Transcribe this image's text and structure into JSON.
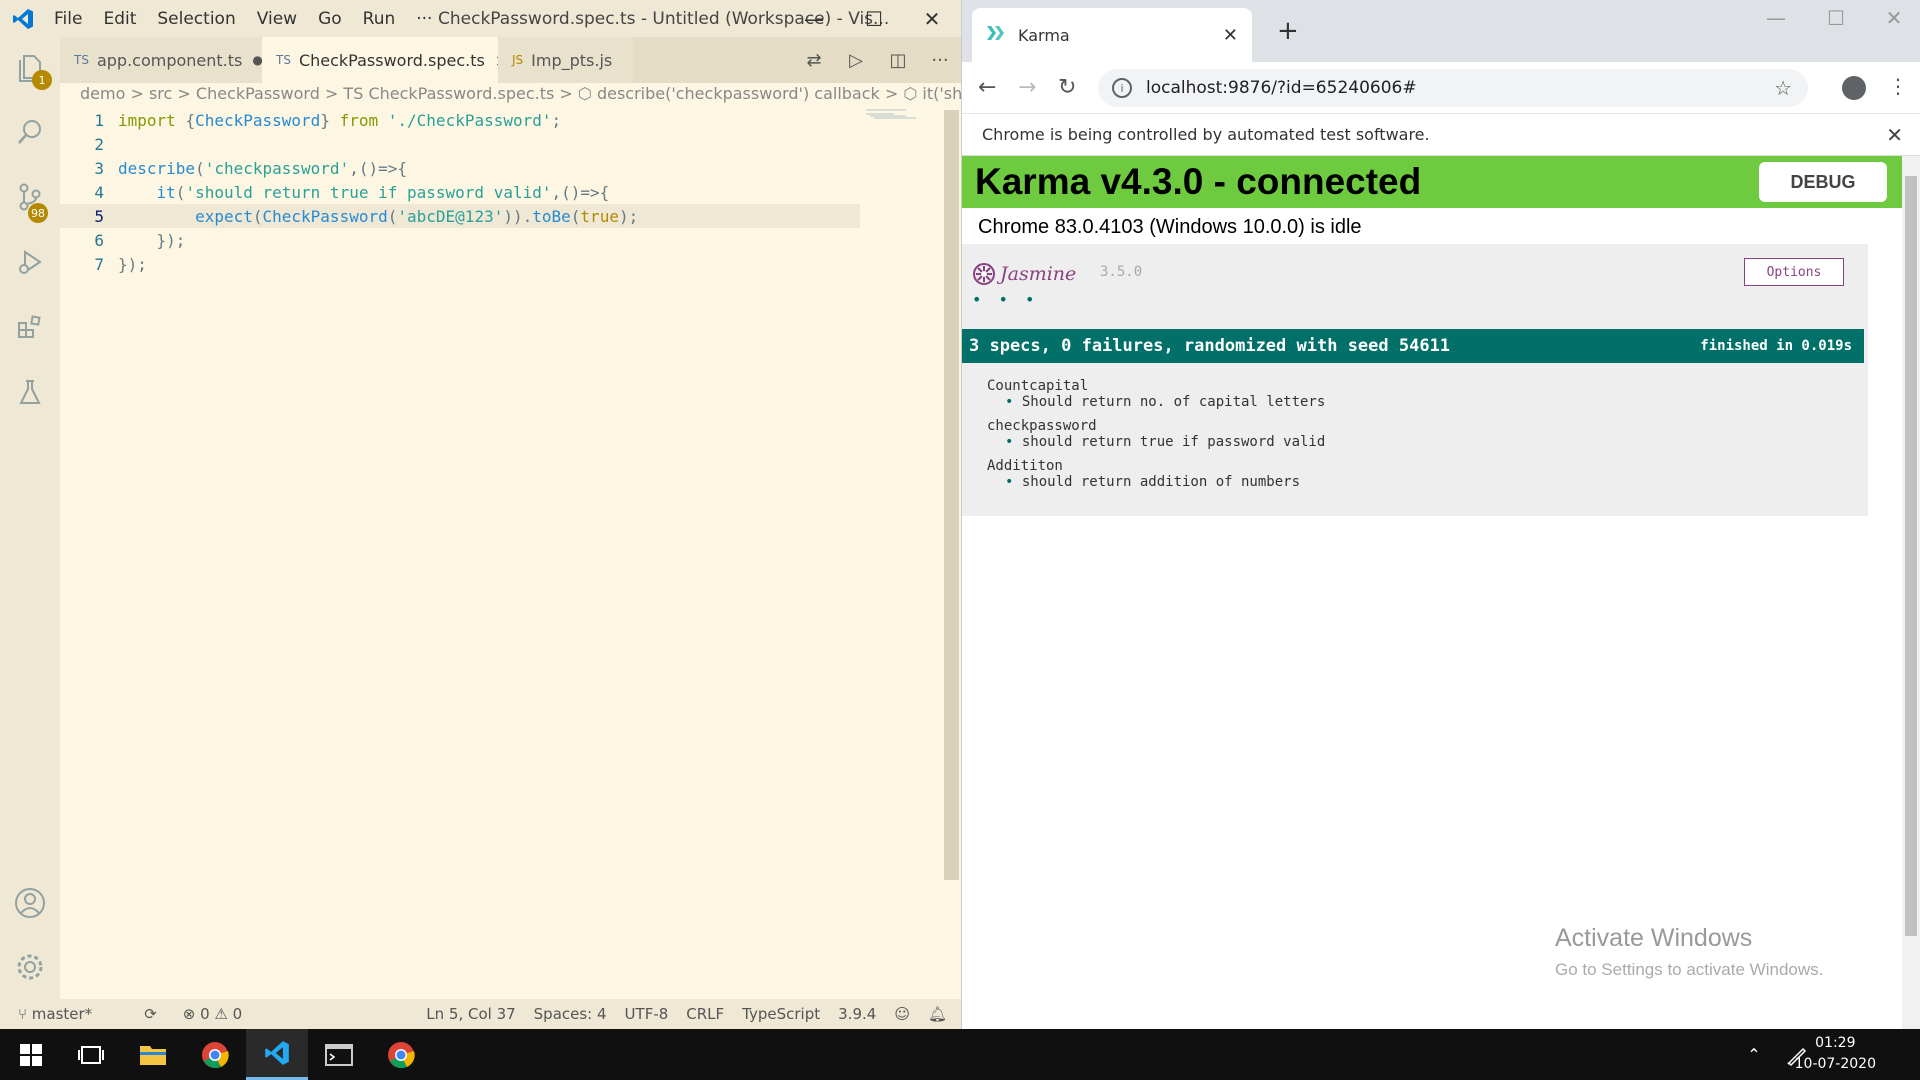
{
  "vscode": {
    "menu": [
      "File",
      "Edit",
      "Selection",
      "View",
      "Go",
      "Run",
      "···"
    ],
    "window_title": "CheckPassword.spec.ts - Untitled (Workspace) - Vis...",
    "tabs": [
      {
        "lang": "TS",
        "label": "app.component.ts",
        "modified": "●"
      },
      {
        "lang": "TS",
        "label": "CheckPassword.spec.ts",
        "close": "×"
      },
      {
        "lang": "JS",
        "label": "Imp_pts.js"
      }
    ],
    "breadcrumb": "demo > src > CheckPassword > TS CheckPassword.spec.ts > ⬡ describe('checkpassword') callback > ⬡ it('should return",
    "badges": {
      "explorer": "1",
      "scm": "98"
    },
    "code": [
      {
        "num": "1",
        "text": "import {CheckPassword} from './CheckPassword';"
      },
      {
        "num": "2",
        "text": ""
      },
      {
        "num": "3",
        "text": "describe('checkpassword',()=>{"
      },
      {
        "num": "4",
        "text": "    it('should return true if password valid',()=>{"
      },
      {
        "num": "5",
        "text": "        expect(CheckPassword('abcDE@123')).toBe(true);"
      },
      {
        "num": "6",
        "text": "    });"
      },
      {
        "num": "7",
        "text": "});"
      }
    ],
    "status": {
      "branch": "master*",
      "errors": "⊗ 0 ⚠ 0",
      "position": "Ln 5, Col 37",
      "spaces": "Spaces: 4",
      "encoding": "UTF-8",
      "eol": "CRLF",
      "language": "TypeScript",
      "version": "3.9.4"
    }
  },
  "chrome": {
    "tab_title": "Karma",
    "url": "localhost:9876/?id=65240606#",
    "infobar": "Chrome is being controlled by automated test software.",
    "karma_title": "Karma v4.3.0 - connected",
    "debug_label": "DEBUG",
    "idle_text": "Chrome 83.0.4103 (Windows 10.0.0) is idle",
    "jasmine": {
      "name": "Jasmine",
      "version": "3.5.0",
      "options_label": "Options",
      "dots": "• • •",
      "summary": "3 specs, 0 failures, randomized with seed 54611",
      "finished": "finished in 0.019s",
      "suites": [
        {
          "name": "Countcapital",
          "spec": "Should return no. of capital letters"
        },
        {
          "name": "checkpassword",
          "spec": "should return true if password valid"
        },
        {
          "name": "Addititon",
          "spec": "should return addition of numbers"
        }
      ]
    },
    "watermark": "Activate Windows",
    "watermark_sub": "Go to Settings to activate Windows."
  },
  "taskbar": {
    "time": "01:29",
    "date": "10-07-2020"
  },
  "colors": {
    "karma_green": "#6ecb3f",
    "jasmine_teal": "#007069",
    "vscode_bg": "#fdf6e3"
  }
}
